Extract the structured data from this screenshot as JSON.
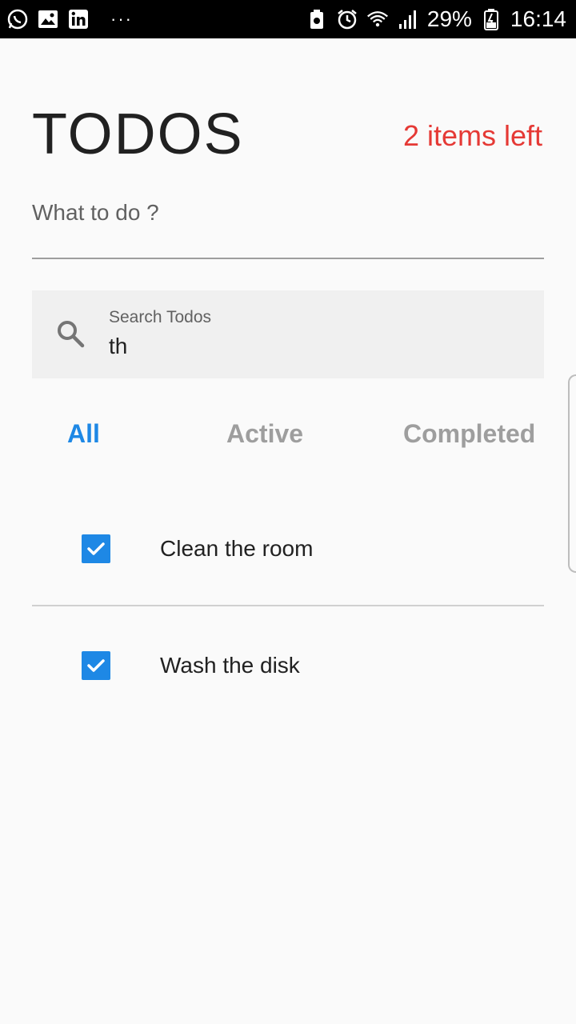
{
  "status_bar": {
    "battery": "29%",
    "time": "16:14",
    "overflow": "···",
    "left_icons": [
      "whatsapp-icon",
      "gallery-icon",
      "linkedin-icon"
    ],
    "right_icons": [
      "battery-saver-icon",
      "alarm-icon",
      "wifi-icon",
      "signal-icon",
      "battery-icon"
    ]
  },
  "header": {
    "title": "TODOS",
    "items_left": "2 items left"
  },
  "new_todo": {
    "placeholder": "What to do ?"
  },
  "search": {
    "label": "Search Todos",
    "value": "th",
    "icon": "search-icon"
  },
  "filters": {
    "all": "All",
    "active": "Active",
    "completed": "Completed",
    "selected": "All"
  },
  "todos": [
    {
      "text": "Clean the room",
      "checked": true
    },
    {
      "text": "Wash the disk",
      "checked": true
    }
  ],
  "colors": {
    "accent": "#1e88e5",
    "items_left": "#e53935",
    "background": "#fafafa"
  }
}
